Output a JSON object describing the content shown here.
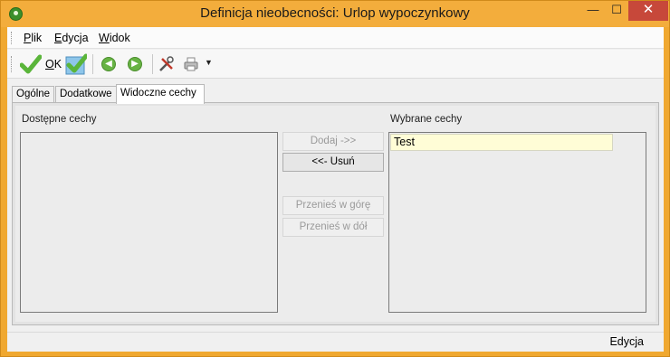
{
  "window": {
    "title": "Definicja nieobecności: Urlop wypoczynkowy",
    "minimize_symbol": "—",
    "maximize_symbol": "☐",
    "close_symbol": "✕"
  },
  "menu": {
    "items": [
      "Plik",
      "Edycja",
      "Widok"
    ]
  },
  "toolbar": {
    "ok_label": "OK",
    "icons": [
      "ok-check-icon",
      "save-check-icon",
      "back-arrow-icon",
      "forward-arrow-icon",
      "tools-icon",
      "printer-icon",
      "dropdown-arrow-icon"
    ],
    "dropdown_symbol": "▼",
    "back_symbol": "◀",
    "forward_symbol": "▶"
  },
  "tabs": [
    "Ogólne",
    "Dodatkowe",
    "Widoczne cechy"
  ],
  "active_tab": "Widoczne cechy",
  "panel": {
    "available_label": "Dostępne cechy",
    "selected_label": "Wybrane cechy",
    "available_items": [],
    "selected_items": [
      "Test"
    ],
    "buttons": {
      "add": "Dodaj ->>",
      "remove": "<<- Usuń",
      "move_up": "Przenieś w górę",
      "move_down": "Przenieś w dół"
    }
  },
  "status": {
    "mode": "Edycja"
  },
  "colors": {
    "title_bar": "#f3ad3c",
    "close_button": "#c7483a",
    "selected_item_bg": "#fffdd6",
    "check_green": "#5ab53a"
  }
}
